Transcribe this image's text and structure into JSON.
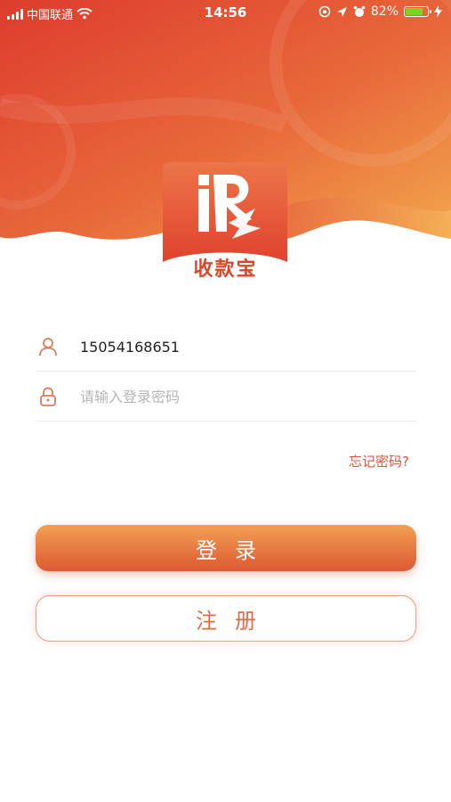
{
  "status_bar": {
    "carrier": "中国联通",
    "time": "14:56",
    "battery_percent": "82%",
    "battery_level": 0.82,
    "icons": [
      "signal-icon",
      "wifi-icon",
      "rotation-lock-icon",
      "location-icon",
      "alarm-icon",
      "battery-icon",
      "charging-icon"
    ]
  },
  "app": {
    "logo_mark": "iR",
    "name": "收款宝"
  },
  "login_form": {
    "phone_value": "15054168651",
    "password_placeholder": "请输入登录密码",
    "forgot_label": "忘记密码?",
    "login_label": "登录",
    "register_label": "注册"
  },
  "colors": {
    "accent": "#e2553a",
    "hero_start": "#e0452f",
    "hero_end": "#f0a04c",
    "field_icon": "#e07a55"
  }
}
